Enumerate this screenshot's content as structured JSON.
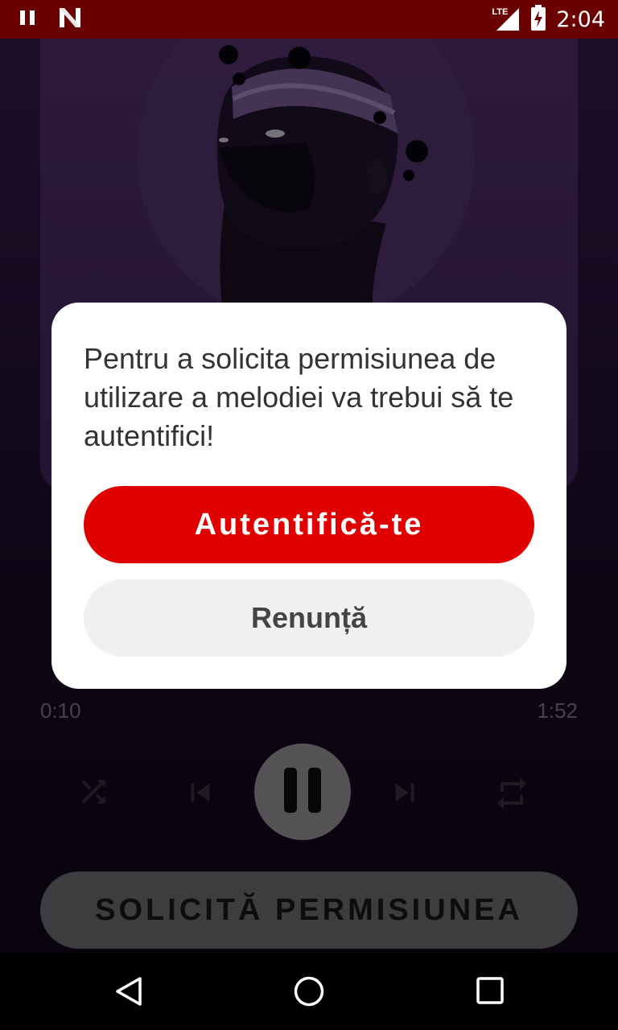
{
  "status_bar": {
    "time": "2:04",
    "network_label": "LTE",
    "icons": [
      "pause-icon",
      "n-notification-icon",
      "lte-signal-icon",
      "battery-charging-icon"
    ],
    "background": "#6b0000"
  },
  "player": {
    "artwork": "illustration of a dark figure with a headband and floating orbs on a purple circle",
    "elapsed": "0:10",
    "duration": "1:52",
    "controls": [
      "shuffle-icon",
      "skip-previous-icon",
      "pause-icon",
      "skip-next-icon",
      "repeat-icon"
    ],
    "request_button_label": "SOLICITĂ PERMISIUNEA"
  },
  "dialog": {
    "message": "Pentru a solicita permisiunea de utilizare a melodiei va trebui să te autentifici!",
    "primary_label": "Autentifică-te",
    "secondary_label": "Renunță",
    "accent": "#e00000"
  },
  "nav_bar": {
    "buttons": [
      "back-icon",
      "home-icon",
      "recents-icon"
    ]
  }
}
